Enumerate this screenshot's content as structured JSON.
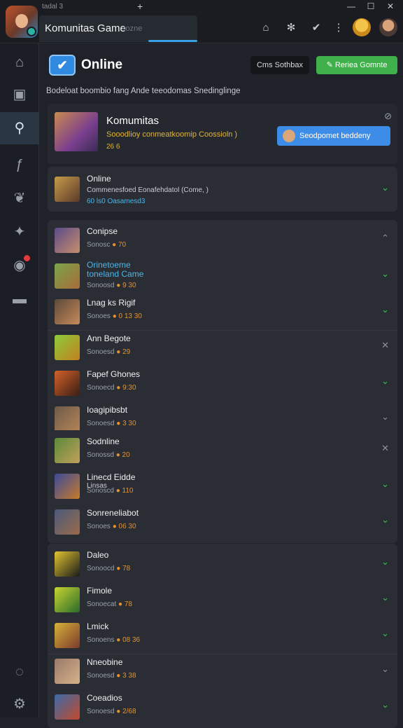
{
  "titlebar": {
    "small_tab": "tadal 3",
    "active_tab_title": "Komunitas Game",
    "active_tab_sub": "sozne",
    "plus": "+",
    "minimize": "—",
    "maximize": "☐",
    "close": "✕",
    "icons": [
      "home-icon",
      "gear-icon",
      "check-icon",
      "more-icon"
    ]
  },
  "sidebar": {
    "items": [
      "home-icon",
      "calendar-icon",
      "search-icon",
      "font-icon",
      "leaf-icon",
      "pin-icon",
      "target-icon",
      "briefcase-icon",
      "chat-icon",
      "settings-icon"
    ]
  },
  "header": {
    "title": "Online",
    "btn_secondary": "Cms Sothbax",
    "btn_primary": "Reriea Gomnte"
  },
  "filters": "Bodeloat boombio fang  Ande teeodomas Snedinglinge",
  "featured": {
    "name": "Komumitas",
    "desc": "Sooodlioy conmeatkoomip Coossioln )",
    "meta": "26  6",
    "corner": "⊘",
    "button": "Seodpomet beddeny"
  },
  "status_card": {
    "title": "Online",
    "desc": "Commenesfoed Eonafehdatol (Come,  )",
    "meta": "60  ls0  Oasamesd3",
    "thumb_color": "#c79b4a"
  },
  "groups": [
    {
      "rows": [
        {
          "title": "Conipse",
          "meta_label": "Sonosc",
          "meta_value": "70",
          "chev": "⌃",
          "chev_color": "gray",
          "thumb": [
            "#5a4a8a",
            "#c98e6a"
          ]
        },
        {
          "title": "Orinetoeme toneland Came",
          "meta_label": "Sonoosd",
          "meta_value": "9 30",
          "chev": "⌄",
          "chev_color": "green",
          "thumb": [
            "#7aa54a",
            "#a86b3a"
          ],
          "blue": true
        },
        {
          "title": "Lnag ks Rigif",
          "meta_label": "Sonoes",
          "meta_value": "0 13 30",
          "chev": "⌄",
          "chev_color": "green",
          "thumb": [
            "#5c4a3a",
            "#c88a5a"
          ]
        },
        {
          "title": "Ann Begote",
          "meta_label": "Sonoesd",
          "meta_value": "29",
          "chev": "✕",
          "chev_color": "gray",
          "thumb": [
            "#8ccc3a",
            "#c2801f"
          ]
        },
        {
          "title": "Fapef Ghones",
          "meta_label": "Sonoecd",
          "meta_value": "9:30",
          "chev": "⌄",
          "chev_color": "green",
          "thumb": [
            "#d4612a",
            "#3a1e14"
          ]
        },
        {
          "title": "Ioagipibsbt",
          "meta_label": "Sonoesd",
          "meta_value": "3 30",
          "chev": "⌄",
          "chev_color": "gray",
          "thumb": [
            "#6b5a4a",
            "#b78455"
          ]
        }
      ]
    },
    {
      "rows": [
        {
          "title": "Sodnline",
          "meta_label": "Sonossd",
          "meta_value": "20",
          "chev": "✕",
          "chev_color": "gray",
          "thumb": [
            "#5a8a3a",
            "#c2a05a"
          ]
        },
        {
          "title": "Linecd Eidde",
          "sub": "Linsas",
          "meta_label": "Sonoscd",
          "meta_value": "110",
          "chev": "⌄",
          "chev_color": "green",
          "thumb": [
            "#3a4a9a",
            "#c87a2a"
          ]
        },
        {
          "title": "Sonreneliabot",
          "meta_label": "Sonoes",
          "meta_value": "06 30",
          "chev": "⌄",
          "chev_color": "green",
          "thumb": [
            "#4a5a7a",
            "#9a6a4a"
          ]
        }
      ]
    },
    {
      "rows": [
        {
          "title": "Daleo",
          "meta_label": "Sonoocd",
          "meta_value": "78",
          "chev": "⌄",
          "chev_color": "green",
          "thumb": [
            "#e2c430",
            "#1a1a1a"
          ]
        },
        {
          "title": "Fimole",
          "meta_label": "Sonoecat",
          "meta_value": "78",
          "chev": "⌄",
          "chev_color": "green",
          "thumb": [
            "#c9d630",
            "#2a6a2a"
          ]
        },
        {
          "title": "Lmick",
          "meta_label": "Sonoens",
          "meta_value": "08 36",
          "chev": "⌄",
          "chev_color": "green",
          "thumb": [
            "#d6b13a",
            "#7a3a2a"
          ]
        },
        {
          "title": "Nneobine",
          "meta_label": "Sonoesd",
          "meta_value": "3 38",
          "chev": "⌄",
          "chev_color": "gray",
          "thumb": [
            "#9a7a6a",
            "#d6b28a"
          ]
        },
        {
          "title": "Coeadios",
          "meta_label": "Sonoesd",
          "meta_value": "2/68",
          "chev": "⌄",
          "chev_color": "green",
          "thumb": [
            "#3a6aaa",
            "#c24a2a"
          ]
        }
      ]
    }
  ]
}
